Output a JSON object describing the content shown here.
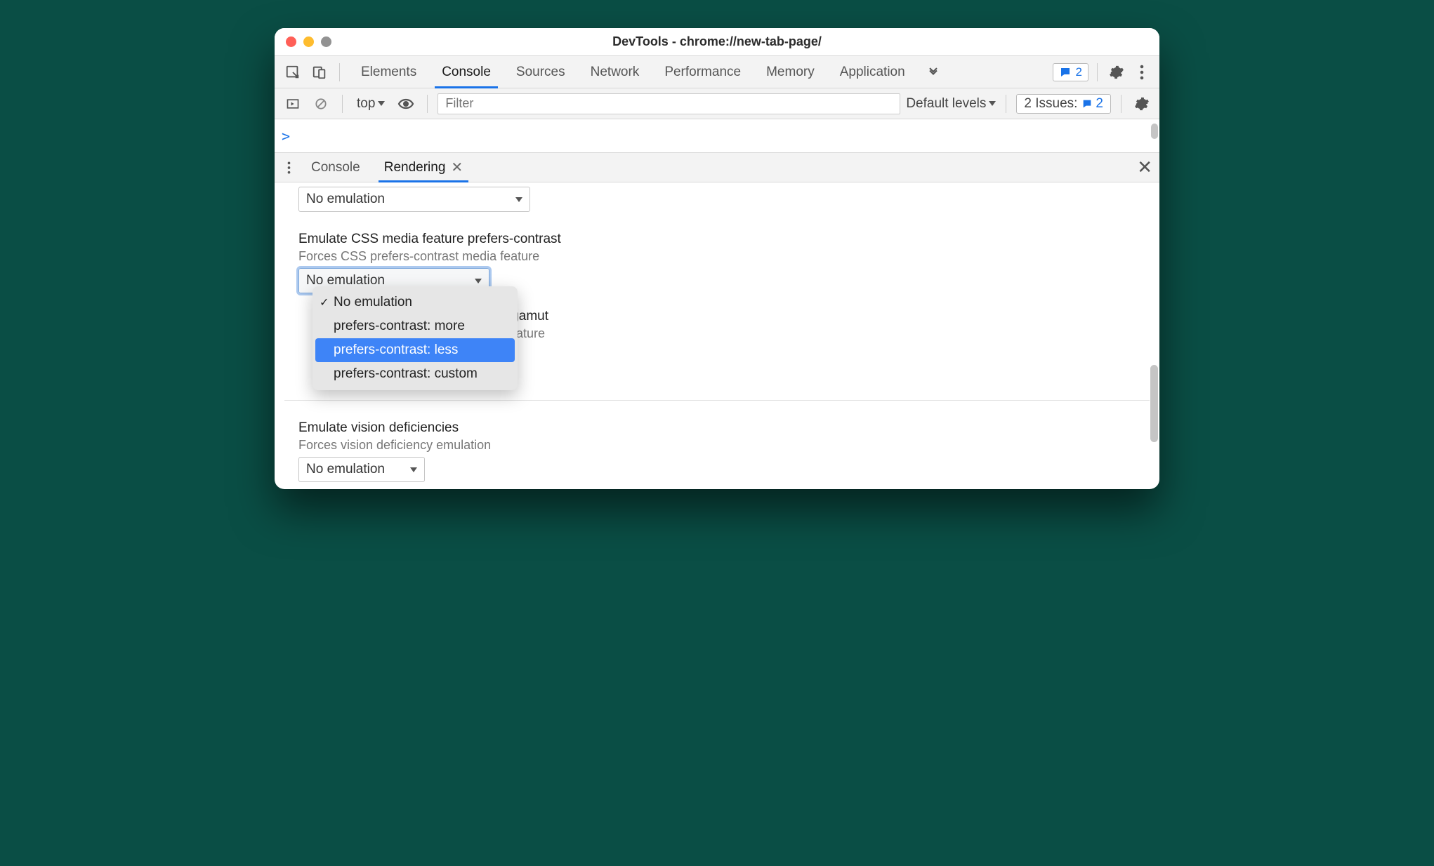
{
  "window": {
    "title": "DevTools - chrome://new-tab-page/"
  },
  "main_tabs": {
    "items": [
      "Elements",
      "Console",
      "Sources",
      "Network",
      "Performance",
      "Memory",
      "Application"
    ],
    "active_index": 1,
    "chat_count": "2"
  },
  "console_bar": {
    "context": "top",
    "filter_placeholder": "Filter",
    "levels_label": "Default levels",
    "issues_label": "2 Issues:",
    "issues_count": "2"
  },
  "prompt": {
    "symbol": ">"
  },
  "drawer": {
    "tabs": [
      "Console",
      "Rendering"
    ],
    "active_index": 1
  },
  "rendering": {
    "top_select": "No emulation",
    "contrast": {
      "title": "Emulate CSS media feature prefers-contrast",
      "desc": "Forces CSS prefers-contrast media feature",
      "selected": "No emulation",
      "options": [
        "No emulation",
        "prefers-contrast: more",
        "prefers-contrast: less",
        "prefers-contrast: custom"
      ],
      "checked_index": 0,
      "highlighted_index": 2
    },
    "gamut": {
      "title_partial": "or-gamut",
      "desc_partial": "a feature"
    },
    "vision": {
      "title": "Emulate vision deficiencies",
      "desc": "Forces vision deficiency emulation",
      "selected": "No emulation"
    }
  }
}
